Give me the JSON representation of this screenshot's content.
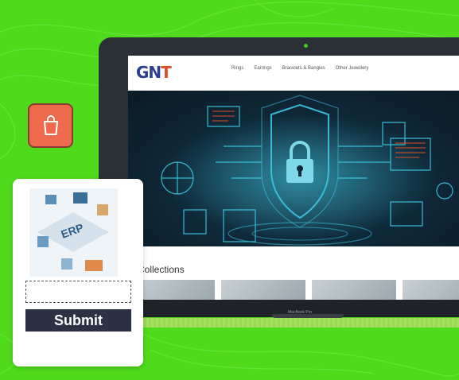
{
  "nav": {
    "logo_prefix": "GN",
    "logo_mark": "T",
    "links": [
      "Rings",
      "Earrings",
      "Bracelets & Bangles",
      "Other Jewellery"
    ]
  },
  "section": {
    "title": "w Collections"
  },
  "laptop": {
    "label": "MacBook Pro"
  },
  "form": {
    "submit_label": "Submit",
    "illustration_text": "ERP"
  },
  "colors": {
    "background": "#4fdb1c",
    "cart_badge": "#ee6a4f",
    "submit_button": "#2c3145",
    "banner_glow": "#3ec7e0"
  },
  "icons": {
    "cart": "shopping-bag-icon",
    "banner": "security-lock-shield-icon"
  }
}
